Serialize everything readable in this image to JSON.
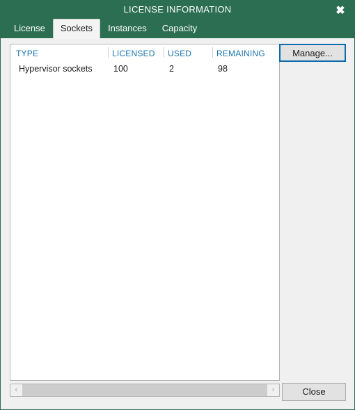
{
  "window": {
    "title": "LICENSE INFORMATION",
    "close_icon": "close-icon",
    "close_glyph": "✖",
    "accent_green": "#2c6e52",
    "header_blue": "#1874ac",
    "focus_blue": "#0a6cad"
  },
  "tabs": [
    {
      "label": "License",
      "active": false
    },
    {
      "label": "Sockets",
      "active": true
    },
    {
      "label": "Instances",
      "active": false
    },
    {
      "label": "Capacity",
      "active": false
    }
  ],
  "table": {
    "columns": [
      "TYPE",
      "LICENSED",
      "USED",
      "REMAINING"
    ],
    "rows": [
      {
        "type": "Hypervisor sockets",
        "licensed": "100",
        "used": "2",
        "remaining": "98"
      }
    ]
  },
  "scrollbar": {
    "left_arrow": "‹",
    "right_arrow": "›"
  },
  "buttons": {
    "manage": "Manage...",
    "close": "Close"
  }
}
